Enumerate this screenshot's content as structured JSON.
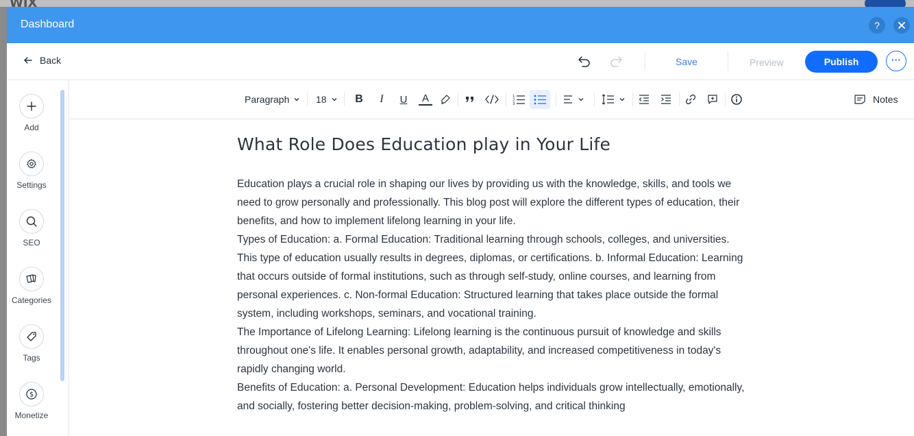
{
  "modal": {
    "title": "Dashboard",
    "help_icon": "question-icon",
    "close_icon": "close-icon"
  },
  "topbar": {
    "back_label": "Back",
    "save_label": "Save",
    "preview_label": "Preview",
    "publish_label": "Publish",
    "more_label": "···"
  },
  "sidebar": {
    "items": [
      {
        "label": "Add",
        "icon": "plus-icon"
      },
      {
        "label": "Settings",
        "icon": "gear-icon"
      },
      {
        "label": "SEO",
        "icon": "search-icon"
      },
      {
        "label": "Categories",
        "icon": "categories-icon"
      },
      {
        "label": "Tags",
        "icon": "tag-icon"
      },
      {
        "label": "Monetize",
        "icon": "dollar-icon"
      }
    ]
  },
  "toolbar": {
    "paragraph_style": "Paragraph",
    "font_size": "18",
    "bold": "B",
    "italic": "I",
    "underline": "U",
    "text_color": "A",
    "notes_label": "Notes"
  },
  "post": {
    "title": "What Role Does Education play in Your Life",
    "paragraphs": [
      "Education plays a crucial role in shaping our lives by providing us with the knowledge, skills, and tools we need to grow personally and professionally. This blog post will explore the different types of education, their benefits, and how to implement lifelong learning in your life.",
      "Types of Education: a. Formal Education: Traditional learning through schools, colleges, and universities. This type of education usually results in degrees, diplomas, or certifications. b. Informal Education: Learning that occurs outside of formal institutions, such as through self-study, online courses, and learning from personal experiences. c. Non-formal Education: Structured learning that takes place outside the formal system, including workshops, seminars, and vocational training.",
      "The Importance of Lifelong Learning: Lifelong learning is the continuous pursuit of knowledge and skills throughout one's life. It enables personal growth, adaptability, and increased competitiveness in today's rapidly changing world.",
      "Benefits of Education: a. Personal Development: Education helps individuals grow intellectually, emotionally, and socially, fostering better decision-making, problem-solving, and critical thinking"
    ]
  },
  "colors": {
    "header_blue": "#3e96ee",
    "publish_blue": "#116dff",
    "save_text": "#3e7fd8",
    "text_dark": "#2b3542"
  }
}
